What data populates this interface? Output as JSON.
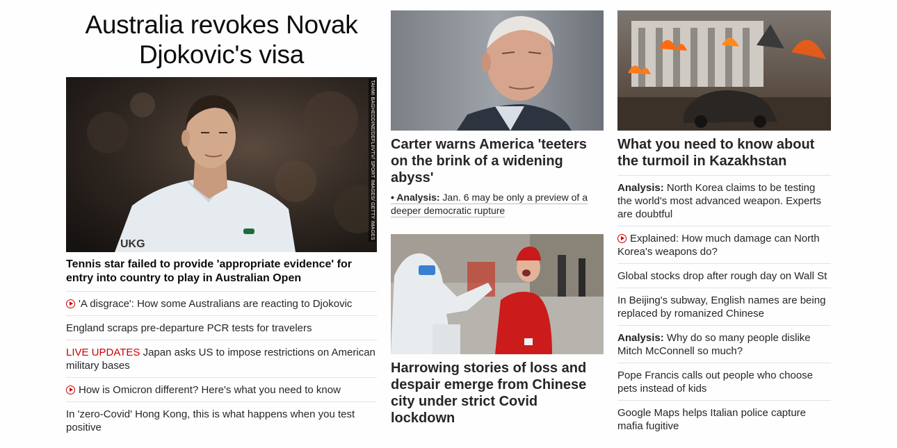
{
  "col1": {
    "banner_headline": "Australia revokes Novak Djokovic's visa",
    "photo_credit": "TAHMI BAGHEDDINE/DEFLIIVTV/ SPORT IMAGES/ GETTY IMAGES",
    "lead_title": "Tennis star failed to provide 'appropriate evidence' for entry into country to play in Australian Open",
    "items": [
      {
        "prefix": "",
        "text": "'A disgrace': How some Australians are reacting to Djokovic",
        "icon": "play-icon"
      },
      {
        "prefix": "",
        "text": "England scraps pre-departure PCR tests for travelers",
        "icon": ""
      },
      {
        "prefix": "LIVE UPDATES",
        "text": " Japan asks US to impose restrictions on American military bases",
        "icon": ""
      },
      {
        "prefix": "",
        "text": "How is Omicron different? Here's what you need to know",
        "icon": "play-icon"
      },
      {
        "prefix": "",
        "text": "In 'zero-Covid' Hong Kong, this is what happens when you test positive",
        "icon": ""
      }
    ]
  },
  "col2": {
    "story1": {
      "title": "Carter warns America 'teeters on the brink of a widening abyss'",
      "sub_bullet": "• ",
      "sub_label": "Analysis:",
      "sub_text": " Jan. 6 may be only a preview of a deeper democratic rupture"
    },
    "story2": {
      "title": "Harrowing stories of loss and despair emerge from Chinese city under strict Covid lockdown"
    }
  },
  "col3": {
    "title": "What you need to know about the turmoil in Kazakhstan",
    "items": [
      {
        "label": "Analysis:",
        "text": " North Korea claims to be testing the world's most advanced weapon. Experts are doubtful",
        "icon": ""
      },
      {
        "label": "",
        "text": "Explained: How much damage can North Korea's weapons do?",
        "icon": "play-icon"
      },
      {
        "label": "",
        "text": "Global stocks drop after rough day on Wall St",
        "icon": ""
      },
      {
        "label": "",
        "text": "In Beijing's subway, English names are being replaced by romanized Chinese",
        "icon": ""
      },
      {
        "label": "Analysis:",
        "text": " Why do so many people dislike Mitch McConnell so much?",
        "icon": ""
      },
      {
        "label": "",
        "text": "Pope Francis calls out people who choose pets instead of kids",
        "icon": ""
      },
      {
        "label": "",
        "text": "Google Maps helps Italian police capture mafia fugitive",
        "icon": ""
      }
    ]
  },
  "colors": {
    "live": "#cc0000",
    "text": "#262626",
    "divider": "#e2e2e2"
  }
}
